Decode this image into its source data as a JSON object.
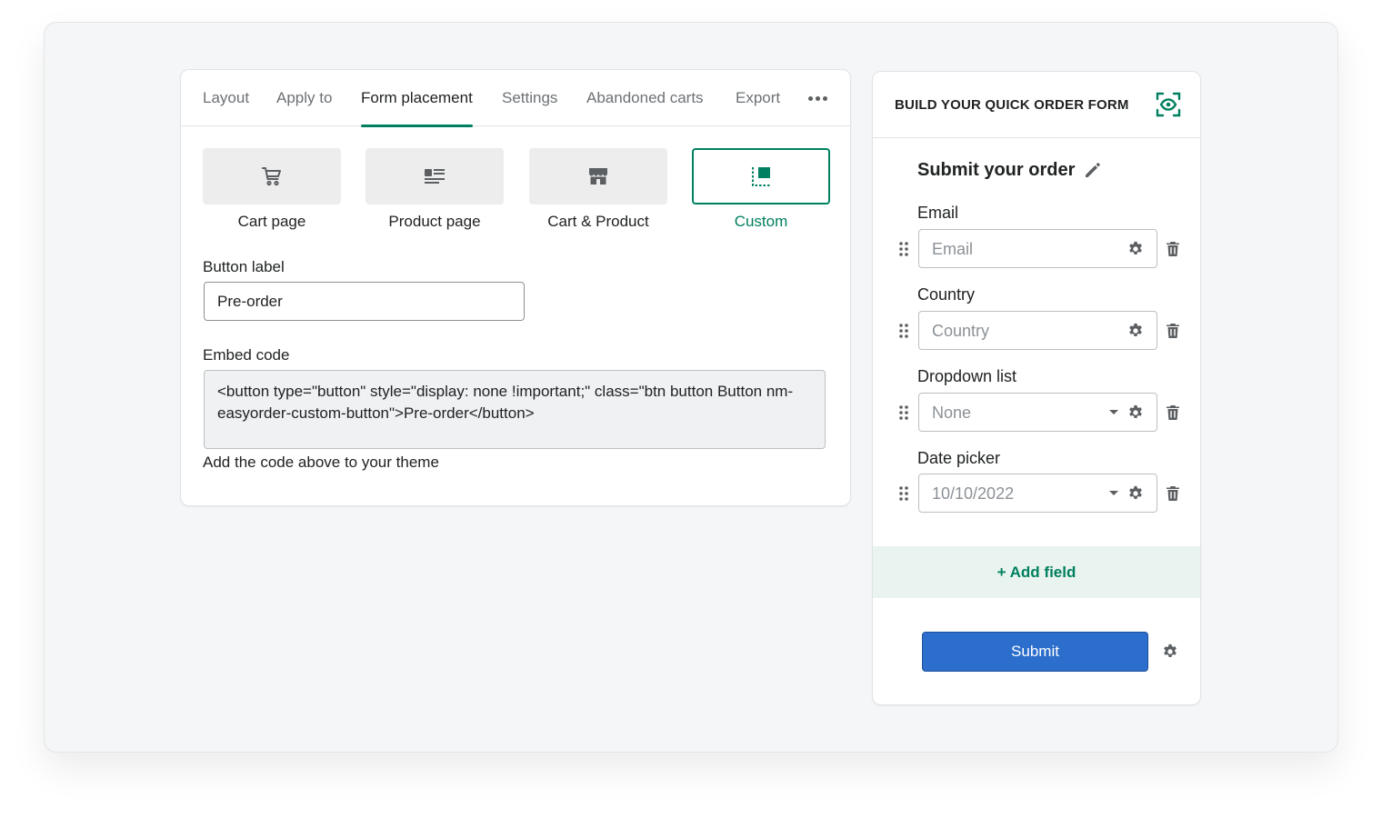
{
  "colors": {
    "accent": "#008060",
    "primary_button": "#2c6ecb",
    "add_field_bg": "#e9f3ef",
    "option_bg": "#ededed"
  },
  "tabs": [
    {
      "label": "Layout",
      "active": false
    },
    {
      "label": "Apply to",
      "active": false
    },
    {
      "label": "Form placement",
      "active": true
    },
    {
      "label": "Settings",
      "active": false
    },
    {
      "label": "Abandoned carts",
      "active": false
    },
    {
      "label": "Export",
      "active": false
    }
  ],
  "more_menu_icon": "horizontal-dots-icon",
  "placement_options": [
    {
      "label": "Cart page",
      "icon": "cart-icon",
      "selected": false
    },
    {
      "label": "Product page",
      "icon": "product-list-icon",
      "selected": false
    },
    {
      "label": "Cart & Product",
      "icon": "store-icon",
      "selected": false
    },
    {
      "label": "Custom",
      "icon": "custom-layout-icon",
      "selected": true
    }
  ],
  "button_label": {
    "label": "Button label",
    "value": "Pre-order"
  },
  "embed_code": {
    "label": "Embed code",
    "code": "<button type=\"button\" style=\"display: none !important;\" class=\"btn button Button nm-easyorder-custom-button\">Pre-order</button>",
    "help": "Add the code above to your theme"
  },
  "builder": {
    "header_title": "BUILD YOUR QUICK ORDER FORM",
    "preview_icon": "eye-preview-icon",
    "form_title": "Submit your order",
    "fields": [
      {
        "label": "Email",
        "placeholder": "Email",
        "type": "text"
      },
      {
        "label": "Country",
        "placeholder": "Country",
        "type": "text"
      },
      {
        "label": "Dropdown list",
        "placeholder": "None",
        "type": "select"
      },
      {
        "label": "Date picker",
        "placeholder": "10/10/2022",
        "type": "select"
      }
    ],
    "add_field_label": "+ Add field",
    "submit_label": "Submit"
  }
}
